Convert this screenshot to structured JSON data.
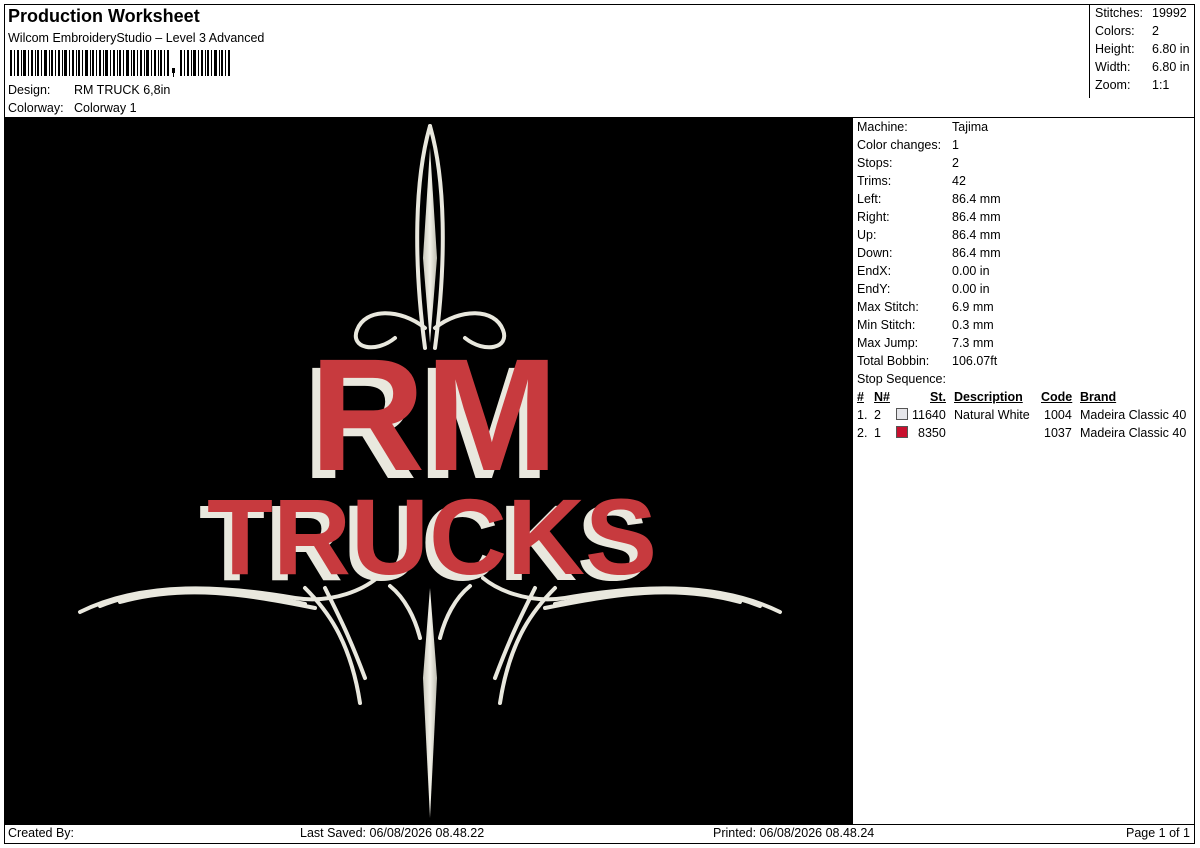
{
  "header": {
    "title": "Production Worksheet",
    "software": "Wilcom EmbroideryStudio – Level 3 Advanced",
    "design_label": "Design:",
    "design_value": "RM TRUCK 6,8in",
    "colorway_label": "Colorway:",
    "colorway_value": "Colorway 1"
  },
  "stats": [
    {
      "key": "Stitches:",
      "value": "19992"
    },
    {
      "key": "Colors:",
      "value": "2"
    },
    {
      "key": "Height:",
      "value": "6.80 in"
    },
    {
      "key": "Width:",
      "value": "6.80 in"
    },
    {
      "key": "Zoom:",
      "value": "1:1"
    }
  ],
  "design_text": {
    "line1": "RM",
    "line2": "TRUCKS"
  },
  "info": [
    {
      "key": "Machine:",
      "value": "Tajima"
    },
    {
      "key": "Color changes:",
      "value": "1"
    },
    {
      "key": "Stops:",
      "value": "2"
    },
    {
      "key": "Trims:",
      "value": "42"
    },
    {
      "key": "Left:",
      "value": "86.4 mm"
    },
    {
      "key": "Right:",
      "value": "86.4 mm"
    },
    {
      "key": "Up:",
      "value": "86.4 mm"
    },
    {
      "key": "Down:",
      "value": "86.4 mm"
    },
    {
      "key": "EndX:",
      "value": "0.00 in"
    },
    {
      "key": "EndY:",
      "value": "0.00 in"
    },
    {
      "key": "Max Stitch:",
      "value": "6.9 mm"
    },
    {
      "key": "Min Stitch:",
      "value": "0.3 mm"
    },
    {
      "key": "Max Jump:",
      "value": "7.3 mm"
    },
    {
      "key": "Total Bobbin:",
      "value": "106.07ft"
    },
    {
      "key": "Stop Sequence:",
      "value": ""
    }
  ],
  "table": {
    "headers": {
      "num": "#",
      "n": "N#",
      "st": "St.",
      "desc": "Description",
      "code": "Code",
      "brand": "Brand"
    },
    "rows": [
      {
        "num": "1.",
        "n": "2",
        "color": "#e6e6ea",
        "st": "11640",
        "desc": "Natural White",
        "code": "1004",
        "brand": "Madeira Classic 40"
      },
      {
        "num": "2.",
        "n": "1",
        "color": "#c8102e",
        "st": "8350",
        "desc": "",
        "code": "1037",
        "brand": "Madeira Classic 40"
      }
    ]
  },
  "footer": {
    "created": "Created By:",
    "saved": "Last Saved: 06/08/2026 08.48.22",
    "printed": "Printed: 06/08/2026 08.48.24",
    "page": "Page 1 of 1"
  }
}
